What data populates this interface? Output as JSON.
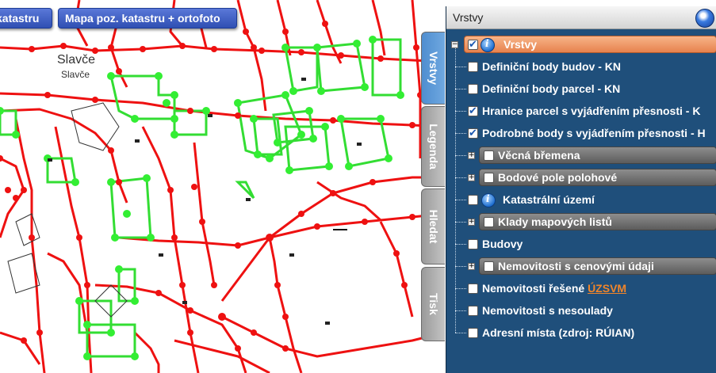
{
  "map": {
    "place_name": "Slavče",
    "place_subname": "Slavče",
    "colors": {
      "parcel_lines": "#ee1111",
      "parcel_points": "#ee1111",
      "building_lines": "#22dd22",
      "building_points": "#33ee33"
    }
  },
  "toolbar": {
    "btn_katastru": "katastru",
    "btn_ortofoto": "Mapa poz. katastru + ortofoto"
  },
  "tabs": [
    "Vrstvy",
    "Legenda",
    "Hledat",
    "Tisk"
  ],
  "panel": {
    "title": "Vrstvy",
    "root_label": "Vrstvy",
    "items": [
      {
        "label": "Definiční body budov - KN",
        "checked": false
      },
      {
        "label": "Definiční body parcel - KN",
        "checked": false
      },
      {
        "label": "Hranice parcel s vyjádřením přesnosti - K",
        "checked": true
      },
      {
        "label": "Podrobné body s vyjádřením přesnosti - H",
        "checked": true
      },
      {
        "label": "Věcná břemena",
        "checked": false,
        "group": true
      },
      {
        "label": "Bodové pole polohové",
        "checked": false,
        "group": true
      },
      {
        "label": "Katastrální území",
        "checked": false,
        "info": true
      },
      {
        "label": "Klady mapových listů",
        "checked": false,
        "group": true
      },
      {
        "label": "Budovy",
        "checked": false
      },
      {
        "label": "Nemovitosti s cenovými údaji",
        "checked": false,
        "group": true
      },
      {
        "label": "Nemovitosti řešené",
        "link": "ÚZSVM",
        "checked": false
      },
      {
        "label": "Nemovitosti s nesoulady",
        "checked": false
      },
      {
        "label": "Adresní místa (zdroj: RÚIAN)",
        "checked": false
      }
    ]
  }
}
